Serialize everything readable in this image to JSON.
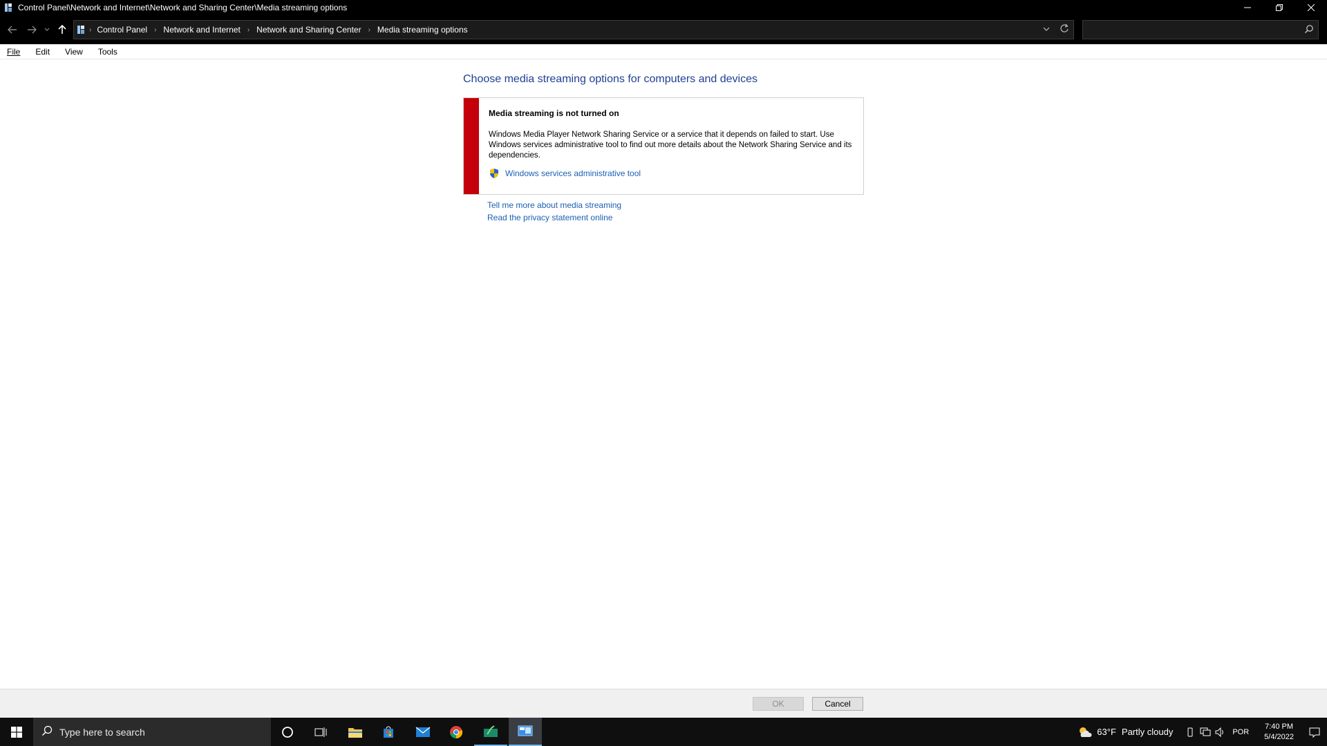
{
  "window": {
    "title": "Control Panel\\Network and Internet\\Network and Sharing Center\\Media streaming options"
  },
  "address": {
    "crumbs": [
      "Control Panel",
      "Network and Internet",
      "Network and Sharing Center",
      "Media streaming options"
    ]
  },
  "menu": {
    "file": "File",
    "edit": "Edit",
    "view": "View",
    "tools": "Tools"
  },
  "main": {
    "title": "Choose media streaming options for computers and devices",
    "error_title": "Media streaming is not turned on",
    "error_message": "Windows Media Player Network Sharing Service or a service that it depends on failed to start.  Use Windows services administrative tool to find out more details about the Network Sharing Service and its dependencies.",
    "admin_link": "Windows services administrative tool",
    "link_more": "Tell me more about media streaming",
    "link_privacy": "Read the privacy statement online"
  },
  "buttons": {
    "ok": "OK",
    "cancel": "Cancel"
  },
  "taskbar": {
    "search_placeholder": "Type here to search",
    "weather_temp": "63°F",
    "weather_text": "Partly cloudy",
    "language": "POR",
    "time": "7:40 PM",
    "date": "5/4/2022"
  },
  "colors": {
    "error_bar": "#c4000a",
    "link": "#1a5fb4",
    "title": "#1e3f93"
  }
}
